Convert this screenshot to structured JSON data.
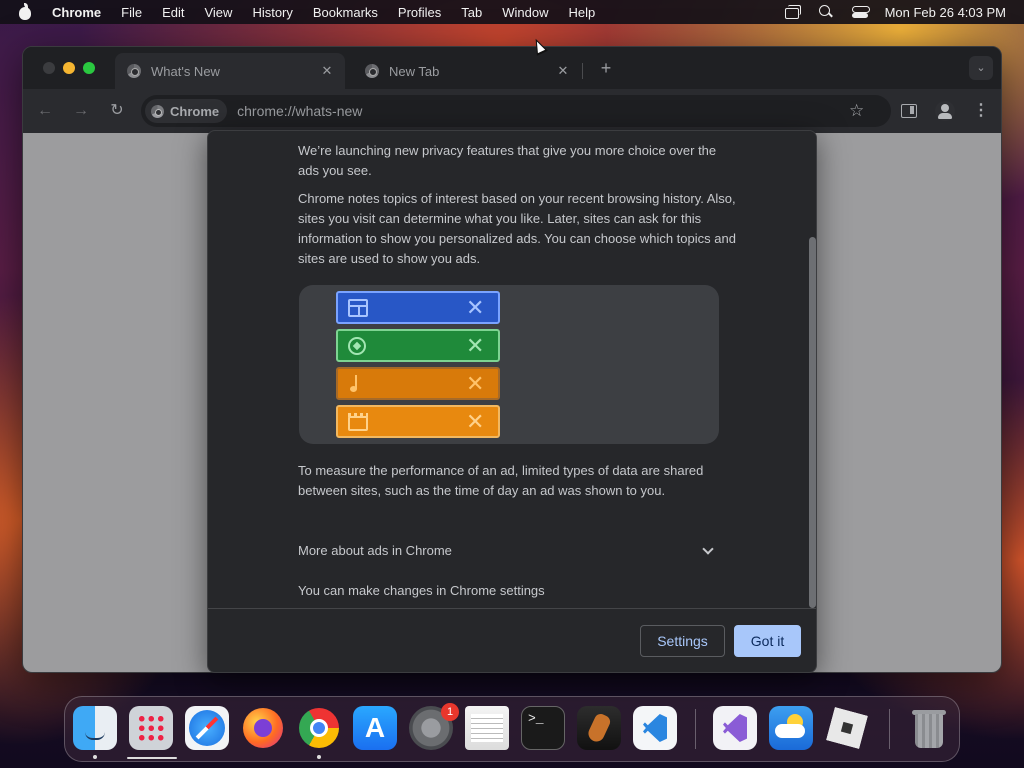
{
  "menubar": {
    "app_name": "Chrome",
    "menus": [
      "File",
      "Edit",
      "View",
      "History",
      "Bookmarks",
      "Profiles",
      "Tab",
      "Window",
      "Help"
    ],
    "clock": "Mon Feb 26  4:03 PM"
  },
  "browser": {
    "tabs": [
      {
        "title": "What's New",
        "active": true
      },
      {
        "title": "New Tab",
        "active": false
      }
    ],
    "new_tab_symbol": "+",
    "close_symbol": "✕",
    "chip_label": "Chrome",
    "url": "chrome://whats-new",
    "star_symbol": "☆",
    "kebab_symbol": "⋮",
    "back_symbol": "←",
    "forward_symbol": "→",
    "reload_symbol": "↻",
    "tab_search_symbol": "⌄"
  },
  "dialog": {
    "paragraph_1": "We’re launching new privacy features that give you more choice over the ads you see.",
    "paragraph_2": "Chrome notes topics of interest based on your recent browsing history. Also, sites you visit can determine what you like. Later, sites can ask for this information to show you personalized ads. You can choose which topics and sites are used to show you ads.",
    "illustration_rows": [
      {
        "icon": "newspaper-icon",
        "color": "#2857c6"
      },
      {
        "icon": "soccer-ball-icon",
        "color": "#1f8a3a"
      },
      {
        "icon": "music-note-icon",
        "color": "#d87a0a"
      },
      {
        "icon": "clapperboard-icon",
        "color": "#e8890f"
      }
    ],
    "remove_symbol": "✕",
    "paragraph_3": "To measure the performance of an ad, limited types of data are shared between sites, such as the time of day an ad was shown to you.",
    "more_about": "More about ads in Chrome",
    "paragraph_4": "You can make changes in Chrome settings",
    "settings_button": "Settings",
    "got_it_button": "Got it",
    "accent_color": "#a8c7fa"
  },
  "dock": {
    "apps": [
      "Finder",
      "Launchpad",
      "Safari",
      "Firefox",
      "Google Chrome",
      "App Store",
      "System Settings",
      "TextEdit",
      "Terminal",
      "GarageBand",
      "Visual Studio Code",
      "Visual Studio",
      "Weather",
      "Roblox",
      "Trash"
    ],
    "system_settings_badge": "1"
  }
}
